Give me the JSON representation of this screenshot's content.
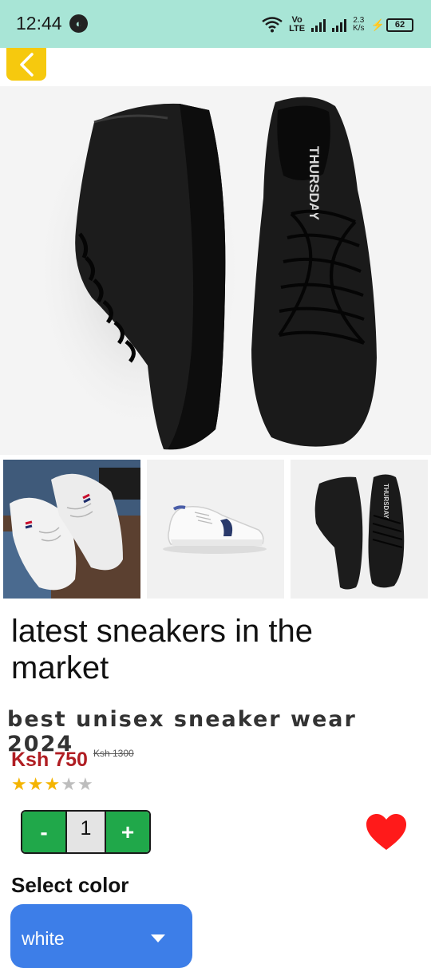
{
  "status_bar": {
    "time": "12:44",
    "network_top": "Vo",
    "network_bottom": "LTE",
    "speed_top": "2.3",
    "speed_bottom": "K/s",
    "battery": "62"
  },
  "icons": {
    "back": "chevron-left-icon",
    "favorite": "heart-icon",
    "dropdown": "caret-down-icon"
  },
  "colors": {
    "status_bar": "#a8e5d6",
    "back_button": "#f6c90e",
    "price": "#b01e23",
    "stepper": "#20a84a",
    "heart": "#ff1a1a",
    "select": "#3d7ee8",
    "star_on": "#f4b400",
    "star_off": "#bdbdbd"
  },
  "product": {
    "title": "latest sneakers in the market",
    "subtitle": "best unisex sneaker wear 2024",
    "price": "Ksh 750",
    "old_price": "Ksh 1300",
    "rating": 3,
    "rating_max": 5,
    "hero_brand_text": "THURSDAY",
    "thumb_brand_text": "THURSDAY"
  },
  "quantity": {
    "minus": "-",
    "value": "1",
    "plus": "+"
  },
  "color_select": {
    "label": "Select color",
    "value": "white"
  }
}
